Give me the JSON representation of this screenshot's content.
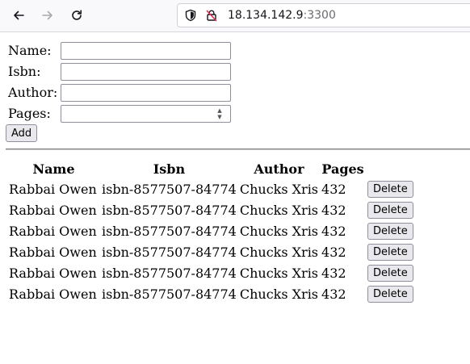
{
  "browser": {
    "url_host": "18.134.142.9",
    "url_port": ":3300"
  },
  "form": {
    "name_label": "Name:",
    "isbn_label": "Isbn:",
    "author_label": "Author:",
    "pages_label": "Pages:",
    "name_value": "",
    "isbn_value": "",
    "author_value": "",
    "pages_value": "",
    "add_label": "Add"
  },
  "table": {
    "headers": [
      "Name",
      "Isbn",
      "Author",
      "Pages"
    ],
    "rows": [
      {
        "name": "Rabbai Owen",
        "isbn": "isbn-8577507-84774",
        "author": "Chucks Xris",
        "pages": "432",
        "action": "Delete"
      },
      {
        "name": "Rabbai Owen",
        "isbn": "isbn-8577507-84774",
        "author": "Chucks Xris",
        "pages": "432",
        "action": "Delete"
      },
      {
        "name": "Rabbai Owen",
        "isbn": "isbn-8577507-84774",
        "author": "Chucks Xris",
        "pages": "432",
        "action": "Delete"
      },
      {
        "name": "Rabbai Owen",
        "isbn": "isbn-8577507-84774",
        "author": "Chucks Xris",
        "pages": "432",
        "action": "Delete"
      },
      {
        "name": "Rabbai Owen",
        "isbn": "isbn-8577507-84774",
        "author": "Chucks Xris",
        "pages": "432",
        "action": "Delete"
      },
      {
        "name": "Rabbai Owen",
        "isbn": "isbn-8577507-84774",
        "author": "Chucks Xris",
        "pages": "432",
        "action": "Delete"
      }
    ]
  }
}
